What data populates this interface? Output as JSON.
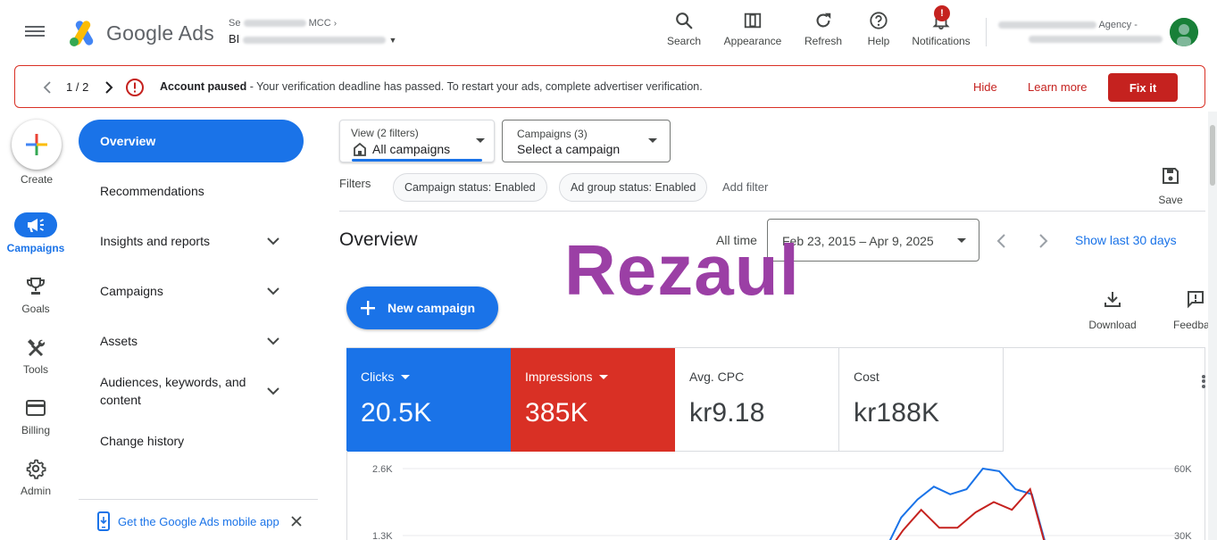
{
  "header": {
    "brand": "Google Ads",
    "account_line1": "Se",
    "account_line2": "BI",
    "account_suffix1": "MCC",
    "agency": "Agency -",
    "tools": [
      {
        "id": "search",
        "label": "Search"
      },
      {
        "id": "appearance",
        "label": "Appearance"
      },
      {
        "id": "refresh",
        "label": "Refresh"
      },
      {
        "id": "help",
        "label": "Help"
      },
      {
        "id": "notifications",
        "label": "Notifications",
        "badge": "!"
      }
    ]
  },
  "alert": {
    "page": "1 / 2",
    "title": "Account paused",
    "message": " - Your verification deadline has passed. To restart your ads, complete advertiser verification.",
    "hide": "Hide",
    "learn_more": "Learn more",
    "fix": "Fix it"
  },
  "rail": {
    "create": "Create",
    "items": [
      {
        "id": "campaigns",
        "label": "Campaigns",
        "active": true
      },
      {
        "id": "goals",
        "label": "Goals"
      },
      {
        "id": "tools",
        "label": "Tools"
      },
      {
        "id": "billing",
        "label": "Billing"
      },
      {
        "id": "admin",
        "label": "Admin"
      }
    ]
  },
  "nav": {
    "overview": "Overview",
    "recommendations": "Recommendations",
    "insights": "Insights and reports",
    "campaigns": "Campaigns",
    "assets": "Assets",
    "audiences_line1": "Audiences, keywords, and",
    "audiences_line2": "content",
    "change_history": "Change history",
    "app_promo": "Get the Google Ads mobile app"
  },
  "filters": {
    "view_small": "View (2 filters)",
    "view_value": "All campaigns",
    "campaigns_small": "Campaigns (3)",
    "campaigns_value": "Select a campaign",
    "label": "Filters",
    "chips": [
      "Campaign status: Enabled",
      "Ad group status: Enabled"
    ],
    "add": "Add filter",
    "save": "Save"
  },
  "overview": {
    "title": "Overview",
    "all_time": "All time",
    "date_range": "Feb 23, 2015 – Apr 9, 2025",
    "last30": "Show last 30 days",
    "new_campaign": "New campaign",
    "download": "Download",
    "feedback": "Feedba",
    "watermark": "Rezaul"
  },
  "metrics": [
    {
      "label": "Clicks",
      "value": "20.5K",
      "color": "#1a73e8",
      "dropdown": true
    },
    {
      "label": "Impressions",
      "value": "385K",
      "color": "#d93025",
      "dropdown": true
    },
    {
      "label": "Avg. CPC",
      "value": "kr9.18"
    },
    {
      "label": "Cost",
      "value": "kr188K"
    }
  ],
  "chart_data": {
    "type": "line",
    "y_left_ticks": [
      "2.6K",
      "1.3K"
    ],
    "y_right_ticks": [
      "60K",
      "30K"
    ],
    "series": [
      {
        "color": "#1a73e8",
        "values": [
          1000,
          1650,
          2000,
          2250,
          2100,
          2200,
          2600,
          2550,
          2200,
          2100,
          950
        ]
      },
      {
        "color": "#c5221f",
        "values": [
          900,
          1400,
          1800,
          1450,
          1450,
          1750,
          1950,
          1800,
          2200,
          900
        ]
      }
    ]
  }
}
